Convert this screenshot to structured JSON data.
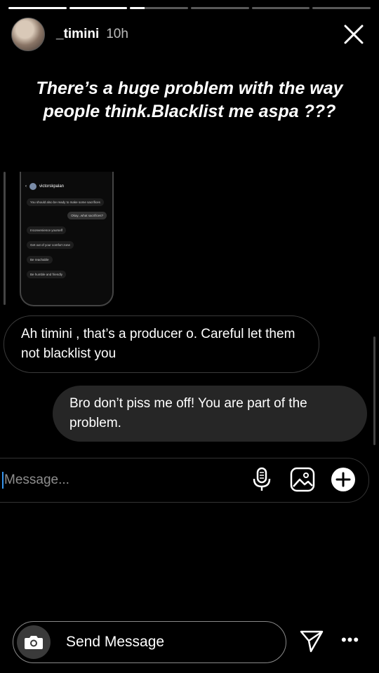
{
  "story": {
    "progress_segments": [
      1,
      1,
      0.25,
      0,
      0,
      0
    ],
    "username": "_timini",
    "time_ago": "10h",
    "caption": "There’s a huge problem with the way people think.Blacklist me aspa ???"
  },
  "screenshot": {
    "contact": "victorskpalan",
    "messages": [
      {
        "side": "in",
        "text": "You should also be ready to make some sacrifices"
      },
      {
        "side": "out",
        "text": "Okay...what sacrifices?"
      },
      {
        "side": "in",
        "text": "Inconvenience yourself"
      },
      {
        "side": "in",
        "text": "Get out of your comfort zone"
      },
      {
        "side": "in",
        "text": "Be reachable"
      },
      {
        "side": "in",
        "text": "Be humble and friendly"
      }
    ]
  },
  "chat": {
    "incoming": "Ah timini , that’s a producer o. Careful let them not blacklist you",
    "outgoing": "Bro don’t piss me off! You are part of the problem."
  },
  "composer": {
    "placeholder": "Message..."
  },
  "footer": {
    "send_message": "Send Message"
  }
}
